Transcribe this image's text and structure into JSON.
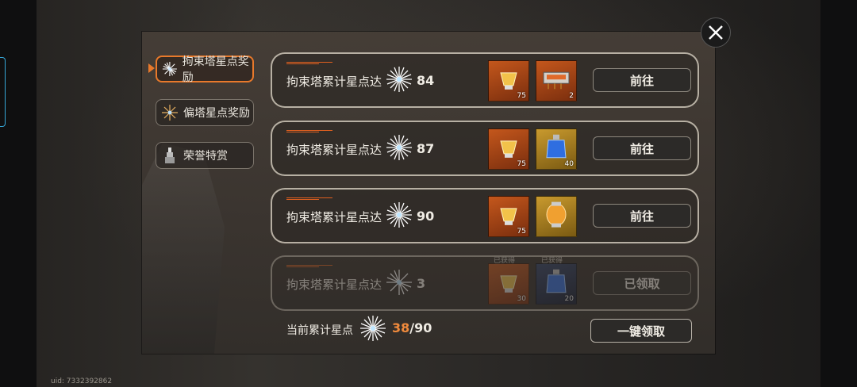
{
  "tabs": [
    {
      "label": "拘束塔星点奖励",
      "active": true,
      "icon": "star-burst-icon"
    },
    {
      "label": "偏塔星点奖励",
      "active": false,
      "icon": "star-burst-icon"
    },
    {
      "label": "荣誉特赏",
      "active": false,
      "icon": "tower-icon"
    }
  ],
  "rows": [
    {
      "label": "拘束塔累计星点达",
      "value": "84",
      "button": "前往",
      "claimed": false,
      "items": [
        {
          "icon": "golden-chest-icon",
          "qty": "75",
          "rarity": "orange"
        },
        {
          "icon": "circuit-module-icon",
          "qty": "2",
          "rarity": "orange"
        }
      ]
    },
    {
      "label": "拘束塔累计星点达",
      "value": "87",
      "button": "前往",
      "claimed": false,
      "items": [
        {
          "icon": "golden-chest-icon",
          "qty": "75",
          "rarity": "orange"
        },
        {
          "icon": "blue-potion-icon",
          "qty": "40",
          "rarity": "gold"
        }
      ]
    },
    {
      "label": "拘束塔累计星点达",
      "value": "90",
      "button": "前往",
      "claimed": false,
      "items": [
        {
          "icon": "golden-chest-icon",
          "qty": "75",
          "rarity": "orange"
        },
        {
          "icon": "amber-crystal-icon",
          "qty": "",
          "rarity": "gold"
        }
      ]
    },
    {
      "label": "拘束塔累计星点达",
      "value": "3",
      "button": "已领取",
      "claimed": true,
      "items": [
        {
          "icon": "golden-chest-icon",
          "qty": "30",
          "rarity": "orange",
          "status": "已获得"
        },
        {
          "icon": "blue-potion-icon",
          "qty": "20",
          "rarity": "blue",
          "status": "已获得"
        }
      ]
    }
  ],
  "footer": {
    "label": "当前累计星点",
    "current": "38",
    "total": "/90",
    "claim_all": "一键领取"
  },
  "uid": "uid: 7332392862",
  "colors": {
    "accent": "#e8792b",
    "count": "#f08a3c"
  }
}
